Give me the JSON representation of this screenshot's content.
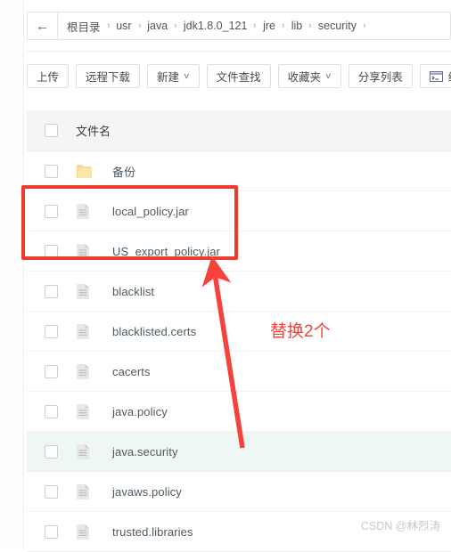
{
  "breadcrumb": {
    "back_icon": "left-arrow-icon",
    "items": [
      "根目录",
      "usr",
      "java",
      "jdk1.8.0_121",
      "jre",
      "lib",
      "security"
    ],
    "separator": "›"
  },
  "toolbar": {
    "buttons": [
      {
        "label": "上传",
        "caret": false,
        "icon": null
      },
      {
        "label": "远程下载",
        "caret": false,
        "icon": null
      },
      {
        "label": "新建",
        "caret": true,
        "icon": null
      },
      {
        "label": "文件查找",
        "caret": false,
        "icon": null
      },
      {
        "label": "收藏夹",
        "caret": true,
        "icon": null
      },
      {
        "label": "分享列表",
        "caret": false,
        "icon": null
      },
      {
        "label": "终端",
        "caret": false,
        "icon": "terminal-icon"
      }
    ],
    "caret_glyph": "∨"
  },
  "table": {
    "header": {
      "filename": "文件名"
    },
    "rows": [
      {
        "name": "备份",
        "type": "folder",
        "selected": false
      },
      {
        "name": "local_policy.jar",
        "type": "file",
        "selected": false
      },
      {
        "name": "US_export_policy.jar",
        "type": "file",
        "selected": false
      },
      {
        "name": "blacklist",
        "type": "file",
        "selected": false
      },
      {
        "name": "blacklisted.certs",
        "type": "file",
        "selected": false
      },
      {
        "name": "cacerts",
        "type": "file",
        "selected": false
      },
      {
        "name": "java.policy",
        "type": "file",
        "selected": false
      },
      {
        "name": "java.security",
        "type": "file",
        "selected": true
      },
      {
        "name": "javaws.policy",
        "type": "file",
        "selected": false
      },
      {
        "name": "trusted.libraries",
        "type": "file",
        "selected": false
      }
    ]
  },
  "annotations": {
    "note_text": "替换2个",
    "note_color": "#f5423b",
    "highlight_box_color": "#ef3b2d",
    "arrow_color": "#f5423b"
  },
  "watermark": {
    "text": "CSDN @林烈涛"
  }
}
